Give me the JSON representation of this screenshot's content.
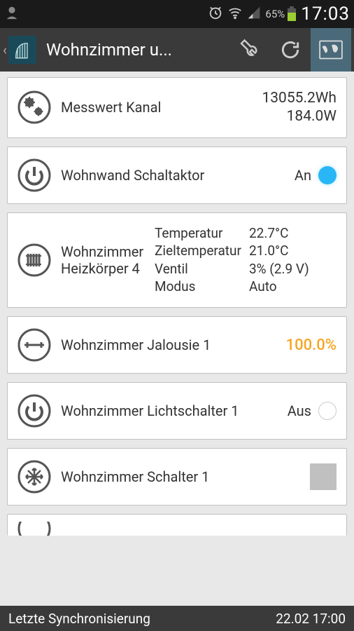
{
  "statusBar": {
    "batteryPct": "65%",
    "time": "17:03"
  },
  "actionBar": {
    "title": "Wohnzimmer u..."
  },
  "cards": {
    "measure": {
      "label": "Messwert Kanal",
      "line1": "13055.2Wh",
      "line2": "184.0W"
    },
    "wallUnit": {
      "label": "Wohnwand Schaltaktor",
      "state": "An"
    },
    "heater": {
      "label1": "Wohnzimmer",
      "label2": "Heizkörper 4",
      "rows": {
        "temp": {
          "label": "Temperatur",
          "value": "22.7°C"
        },
        "target": {
          "label": "Zieltemperatur",
          "value": "21.0°C"
        },
        "valve": {
          "label": "Ventil",
          "value": "3% (2.9 V)"
        },
        "mode": {
          "label": "Modus",
          "value": "Auto"
        }
      }
    },
    "blind": {
      "label": "Wohnzimmer Jalousie 1",
      "value": "100.0%"
    },
    "light": {
      "label": "Wohnzimmer Lichtschalter 1",
      "state": "Aus"
    },
    "switch1": {
      "label": "Wohnzimmer Schalter 1"
    }
  },
  "footer": {
    "label": "Letzte Synchronisierung",
    "time": "22.02 17:00"
  }
}
